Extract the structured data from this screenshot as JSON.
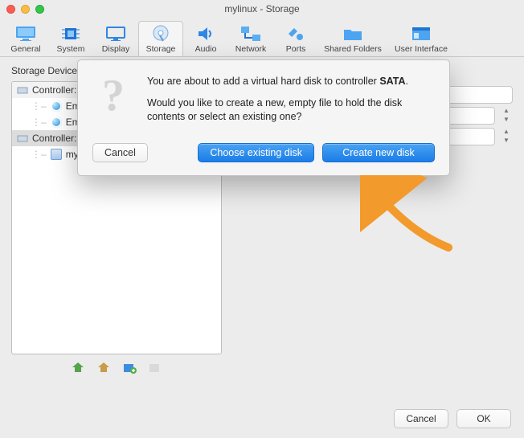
{
  "window": {
    "title": "mylinux - Storage"
  },
  "toolbar": {
    "tabs": [
      {
        "label": "General"
      },
      {
        "label": "System"
      },
      {
        "label": "Display"
      },
      {
        "label": "Storage"
      },
      {
        "label": "Audio"
      },
      {
        "label": "Network"
      },
      {
        "label": "Ports"
      },
      {
        "label": "Shared Folders"
      },
      {
        "label": "User Interface"
      }
    ]
  },
  "storage": {
    "section_label": "Storage Devices",
    "tree": {
      "controller_ide": "Controller: IDE",
      "ide_child1": "Empty",
      "ide_child2": "Empty",
      "controller_sata": "Controller: SATA",
      "sata_child1": "mylinux.vdi"
    }
  },
  "modal": {
    "line1_a": "You are about to add a virtual hard disk to controller ",
    "line1_b": "SATA",
    "line1_c": ".",
    "line2": "Would you like to create a new, empty file to hold the disk contents or select an existing one?",
    "cancel": "Cancel",
    "choose": "Choose existing disk",
    "create": "Create new disk"
  },
  "footer": {
    "cancel": "Cancel",
    "ok": "OK"
  }
}
